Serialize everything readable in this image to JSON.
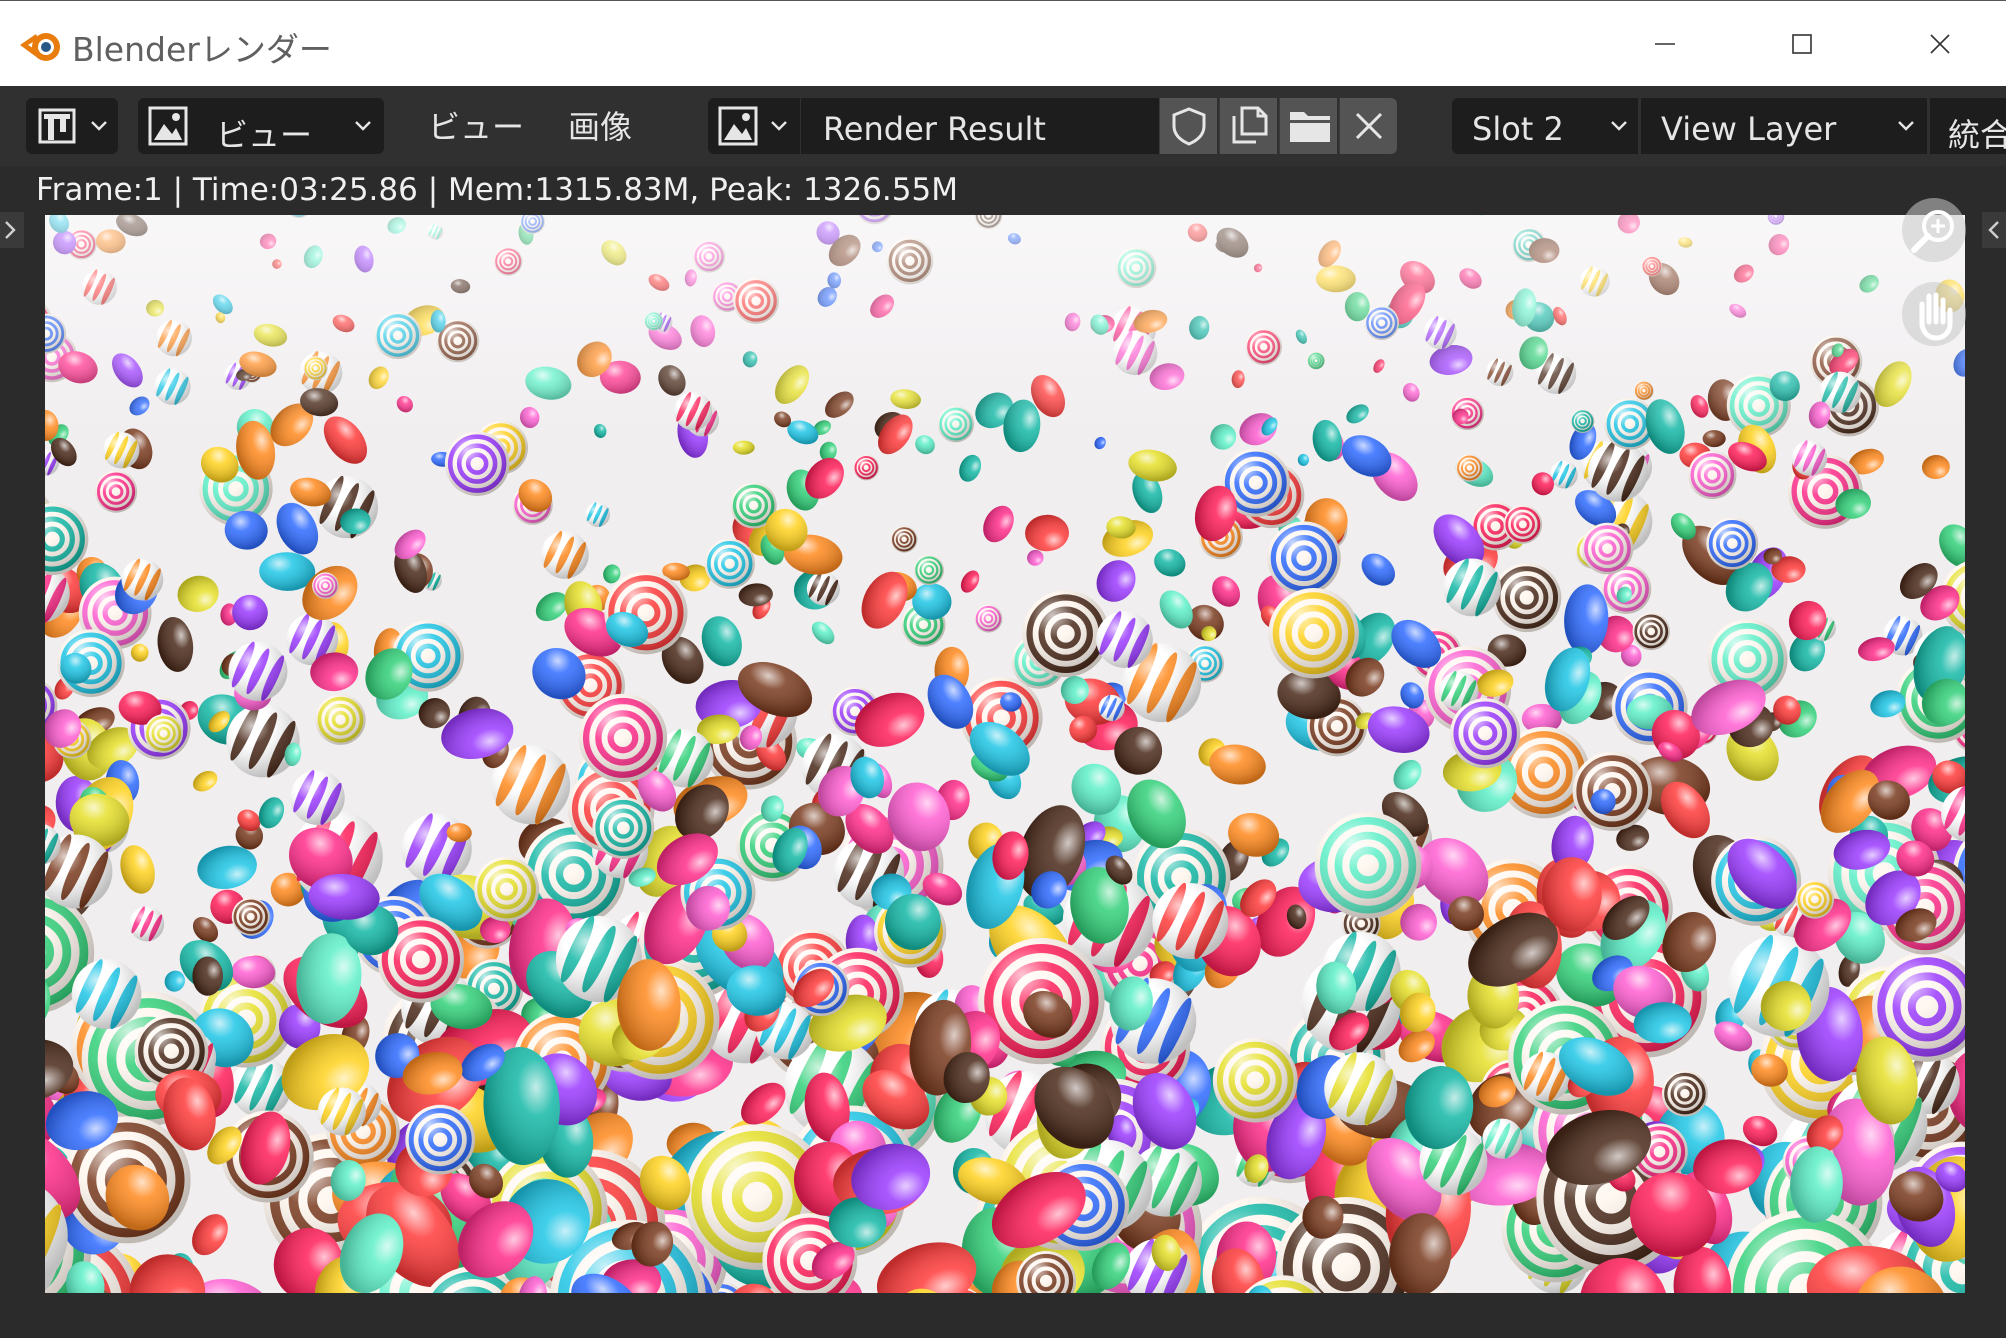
{
  "window": {
    "title": "Blenderレンダー"
  },
  "header": {
    "editor_type_icon": "image-editor-icon",
    "view_mode_label": "ビュー",
    "menus": [
      "ビュー",
      "画像"
    ],
    "image_name": "Render Result",
    "slot": "Slot 2",
    "view_layer": "View Layer",
    "pass": "統合"
  },
  "status": {
    "text": "Frame:1 | Time:03:25.86 | Mem:1315.83M, Peak: 1326.55M"
  },
  "colors": {
    "accent": "#e87d0d",
    "header_bg": "#303030",
    "field_bg": "#1d1d1d",
    "icon_button_bg": "#545454"
  }
}
